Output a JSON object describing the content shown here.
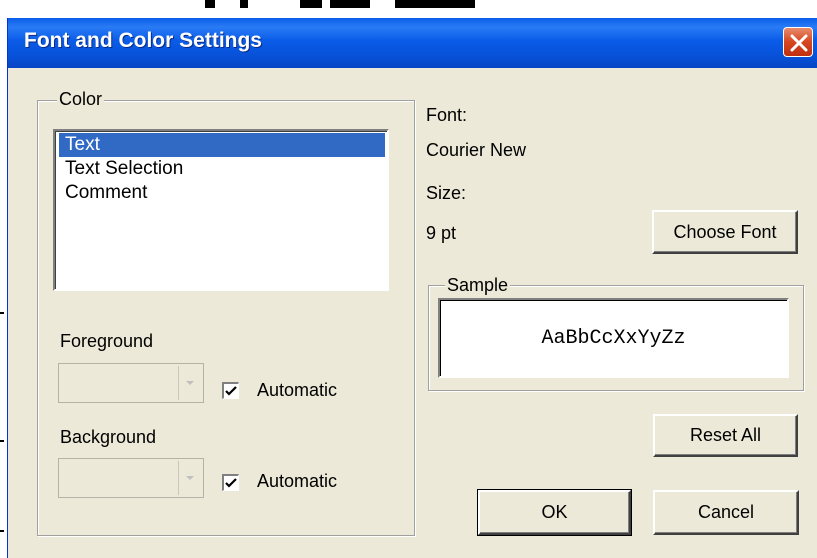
{
  "window": {
    "title": "Font and Color Settings"
  },
  "color_group": {
    "label": "Color",
    "items": [
      {
        "label": "Text",
        "selected": true
      },
      {
        "label": "Text Selection",
        "selected": false
      },
      {
        "label": "Comment",
        "selected": false
      }
    ],
    "foreground": {
      "label": "Foreground",
      "automatic_label": "Automatic",
      "automatic_checked": true,
      "value": ""
    },
    "background": {
      "label": "Background",
      "automatic_label": "Automatic",
      "automatic_checked": true,
      "value": ""
    }
  },
  "font": {
    "font_label": "Font:",
    "font_value": "Courier New",
    "size_label": "Size:",
    "size_value": "9 pt",
    "choose_font_label": "Choose Font"
  },
  "sample": {
    "label": "Sample",
    "text": "AaBbCcXxYyZz"
  },
  "buttons": {
    "reset_all": "Reset All",
    "ok": "OK",
    "cancel": "Cancel"
  },
  "colors": {
    "titlebar": "#0a5ce8",
    "selection": "#316ac5",
    "dialog_bg": "#ece9d8",
    "close": "#d6461f"
  },
  "icons": {
    "close": "close-icon",
    "dropdown": "chevron-down-icon",
    "check": "check-icon"
  }
}
